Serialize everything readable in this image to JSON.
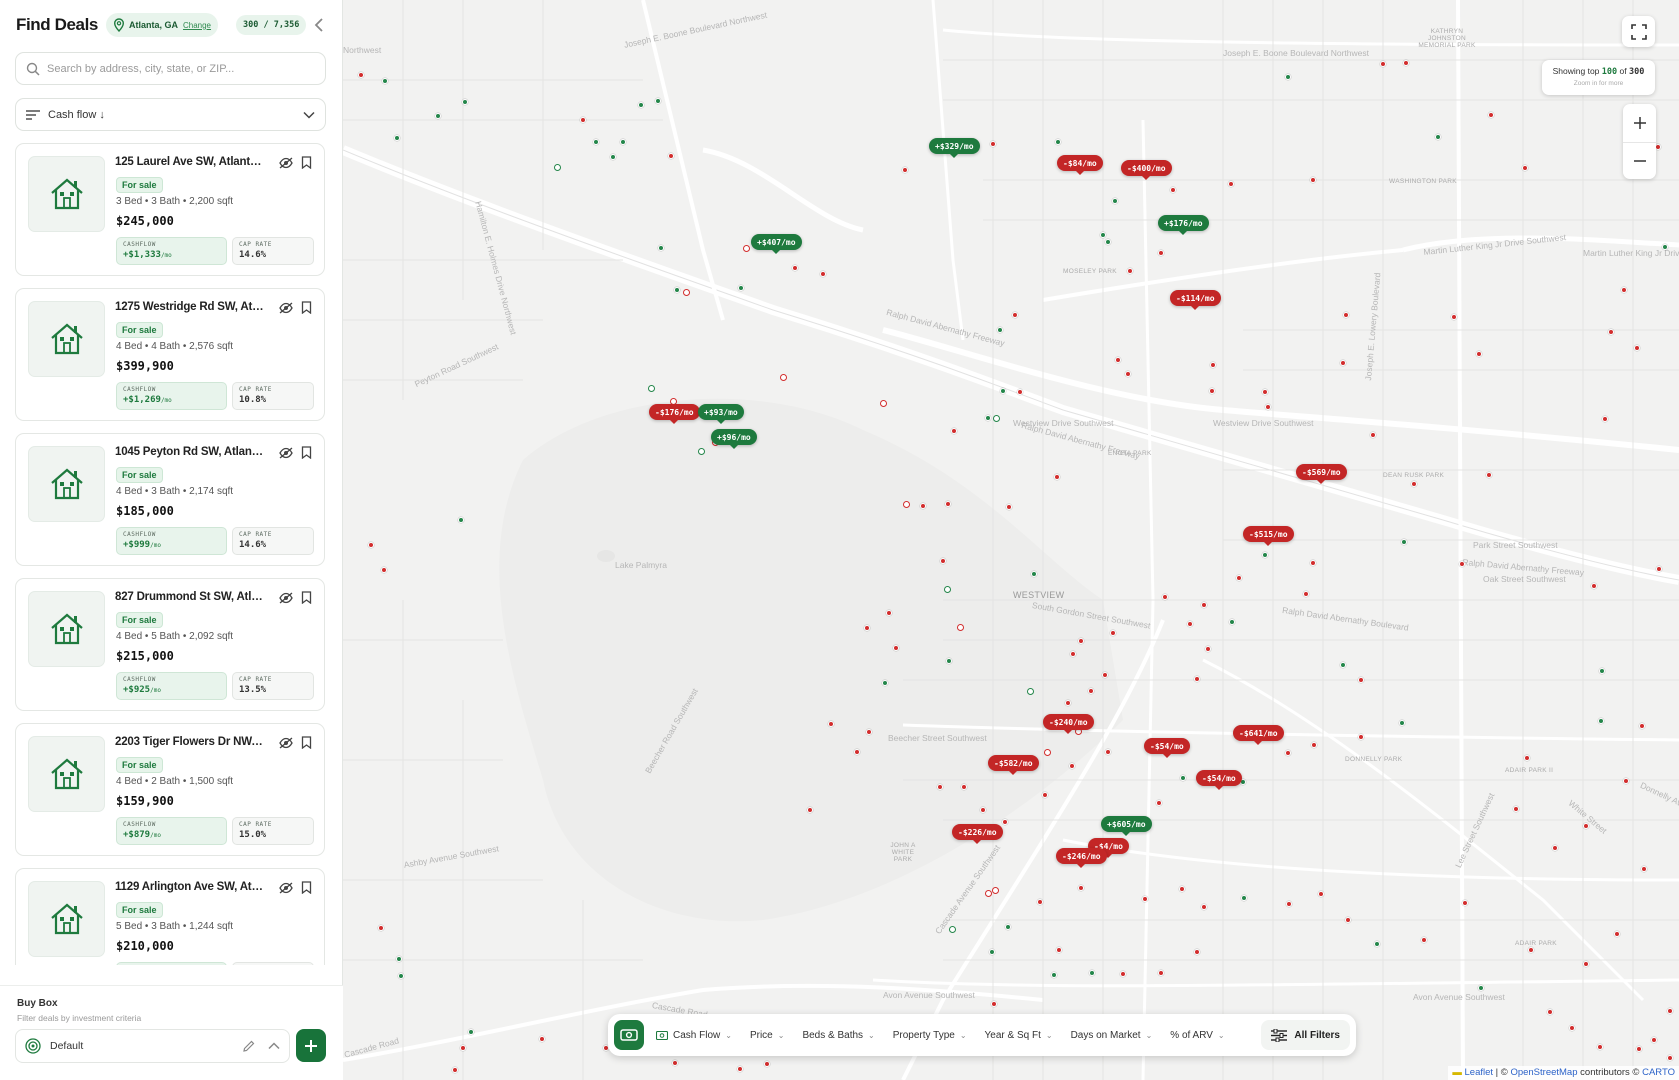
{
  "sidebar": {
    "title": "Find Deals",
    "location": {
      "city": "Atlanta, GA",
      "change_label": "Change"
    },
    "count": "300 / 7,356",
    "search_placeholder": "Search by address, city, state, or ZIP...",
    "sort_label": "Cash flow ↓",
    "listings": [
      {
        "address": "125 Laurel Ave SW, Atlanta, ...",
        "status": "For sale",
        "specs": "3 Bed • 3 Bath • 2,200 sqft",
        "price": "$245,000",
        "cashflow_label": "CASHFLOW",
        "cashflow": "+$1,333",
        "cap_label": "CAP RATE",
        "cap_rate": "14.6%"
      },
      {
        "address": "1275 Westridge Rd SW, Atlan...",
        "status": "For sale",
        "specs": "4 Bed • 4 Bath • 2,576 sqft",
        "price": "$399,900",
        "cashflow_label": "CASHFLOW",
        "cashflow": "+$1,269",
        "cap_label": "CAP RATE",
        "cap_rate": "10.8%"
      },
      {
        "address": "1045 Peyton Rd SW, Atlanta, ...",
        "status": "For sale",
        "specs": "4 Bed • 3 Bath • 2,174 sqft",
        "price": "$185,000",
        "cashflow_label": "CASHFLOW",
        "cashflow": "+$999",
        "cap_label": "CAP RATE",
        "cap_rate": "14.6%"
      },
      {
        "address": "827 Drummond St SW, Atlant...",
        "status": "For sale",
        "specs": "4 Bed • 5 Bath • 2,092 sqft",
        "price": "$215,000",
        "cashflow_label": "CASHFLOW",
        "cashflow": "+$925",
        "cap_label": "CAP RATE",
        "cap_rate": "13.5%"
      },
      {
        "address": "2203 Tiger Flowers Dr NW, A...",
        "status": "For sale",
        "specs": "4 Bed • 2 Bath • 1,500 sqft",
        "price": "$159,900",
        "cashflow_label": "CASHFLOW",
        "cashflow": "+$879",
        "cap_label": "CAP RATE",
        "cap_rate": "15.0%"
      },
      {
        "address": "1129 Arlington Ave SW, Atlant...",
        "status": "For sale",
        "specs": "5 Bed • 3 Bath • 1,244 sqft",
        "price": "$210,000",
        "cashflow_label": "",
        "cashflow": "",
        "cap_label": "",
        "cap_rate": ""
      }
    ],
    "per_month": "/mo",
    "buy_box": {
      "title": "Buy Box",
      "subtitle": "Filter deals by investment criteria",
      "selected": "Default"
    }
  },
  "map": {
    "showing": {
      "prefix": "Showing top",
      "shown": "100",
      "of": "of",
      "total": "300",
      "hint": "Zoom in for more"
    },
    "street_labels": [
      "Joseph E. Boone Boulevard Northwest",
      "Joseph E. Boone Boulevard Northwest",
      "Martin Luther King Jr Drive Southwest",
      "Martin Luther King Jr Drive Southwest",
      "Ralph David Abernathy Freeway",
      "Ralph David Abernathy Freeway",
      "Westview Drive Southwest",
      "Westview Drive Southwest",
      "Ralph David Abernathy Boulevard",
      "Park Street Southwest",
      "Ralph David Abernathy Freeway",
      "Oak Street Southwest",
      "Peyton Road Southwest",
      "Cascade Road",
      "Cascade Road",
      "Cascade Road",
      "Avon Avenue Southwest",
      "Avon Avenue Southwest",
      "Beecher Street Southwest",
      "Beecher Road Southwest",
      "Hamilton E. Holmes Drive Northwest",
      "Cascade Avenue Southwest",
      "White Street",
      "Lee Street Southwest",
      "Joseph E. Lowery Boulevard",
      "Donnelly Avenue Southwest",
      "Lake Palmyra",
      "South Gordon Street Southwest",
      "Ashby Avenue Southwest",
      "Northwest"
    ],
    "places": [
      "KATHRYN JOHNSTON MEMORIAL PARK",
      "WASHINGTON PARK",
      "MOSELEY PARK",
      "ENOTA PARK",
      "DEAN RUSK PARK",
      "WESTVIEW",
      "DONNELLY PARK",
      "ADAIR PARK II",
      "ADAIR PARK",
      "JOHN A WHITE PARK"
    ],
    "markers": [
      {
        "label": "+$329/mo",
        "kind": "g"
      },
      {
        "label": "-$84/mo",
        "kind": "r"
      },
      {
        "label": "-$400/mo",
        "kind": "r"
      },
      {
        "label": "+$176/mo",
        "kind": "g"
      },
      {
        "label": "+$407/mo",
        "kind": "g"
      },
      {
        "label": "-$114/mo",
        "kind": "r"
      },
      {
        "label": "-$176/mo",
        "kind": "r"
      },
      {
        "label": "+$93/mo",
        "kind": "g"
      },
      {
        "label": "+$96/mo",
        "kind": "g"
      },
      {
        "label": "-$569/mo",
        "kind": "r"
      },
      {
        "label": "-$515/mo",
        "kind": "r"
      },
      {
        "label": "-$240/mo",
        "kind": "r"
      },
      {
        "label": "-$641/mo",
        "kind": "r"
      },
      {
        "label": "-$54/mo",
        "kind": "r"
      },
      {
        "label": "-$582/mo",
        "kind": "r"
      },
      {
        "label": "-$54/mo",
        "kind": "r"
      },
      {
        "label": "+$605/mo",
        "kind": "g"
      },
      {
        "label": "-$226/mo",
        "kind": "r"
      },
      {
        "label": "-$4/mo",
        "kind": "r"
      },
      {
        "label": "-$246/mo",
        "kind": "r"
      }
    ],
    "filters": [
      "Cash Flow",
      "Price",
      "Beds & Baths",
      "Property Type",
      "Year & Sq Ft",
      "Days on Market",
      "% of ARV"
    ],
    "all_filters": "All Filters",
    "attribution": {
      "leaflet": "Leaflet",
      "sep": " | © ",
      "osm": "OpenStreetMap",
      "mid": " contributors © ",
      "carto": "CARTO"
    },
    "colors": {
      "brand_green": "#1e7a3e",
      "negative_red": "#c32626"
    }
  }
}
